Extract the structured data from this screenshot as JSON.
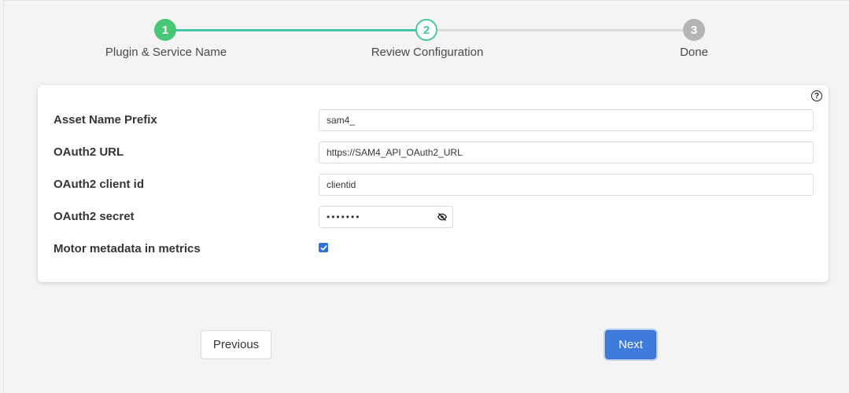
{
  "stepper": {
    "steps": [
      {
        "number": "1",
        "label": "Plugin & Service Name",
        "state": "complete"
      },
      {
        "number": "2",
        "label": "Review Configuration",
        "state": "active"
      },
      {
        "number": "3",
        "label": "Done",
        "state": "pending"
      }
    ]
  },
  "form": {
    "help_icon": "?",
    "fields": [
      {
        "label": "Asset Name Prefix",
        "value": "sam4_"
      },
      {
        "label": "OAuth2 URL",
        "value": "https://SAM4_API_OAuth2_URL"
      },
      {
        "label": "OAuth2 client id",
        "value": "clientid"
      },
      {
        "label": "OAuth2 secret",
        "value": "•••••••"
      },
      {
        "label": "Motor metadata in metrics",
        "checked": true
      }
    ]
  },
  "actions": {
    "previous_label": "Previous",
    "next_label": "Next"
  },
  "colors": {
    "complete": "#48c774",
    "active": "#48c7a2",
    "pending": "#b5b5b5",
    "primary": "#3e7bdc"
  }
}
